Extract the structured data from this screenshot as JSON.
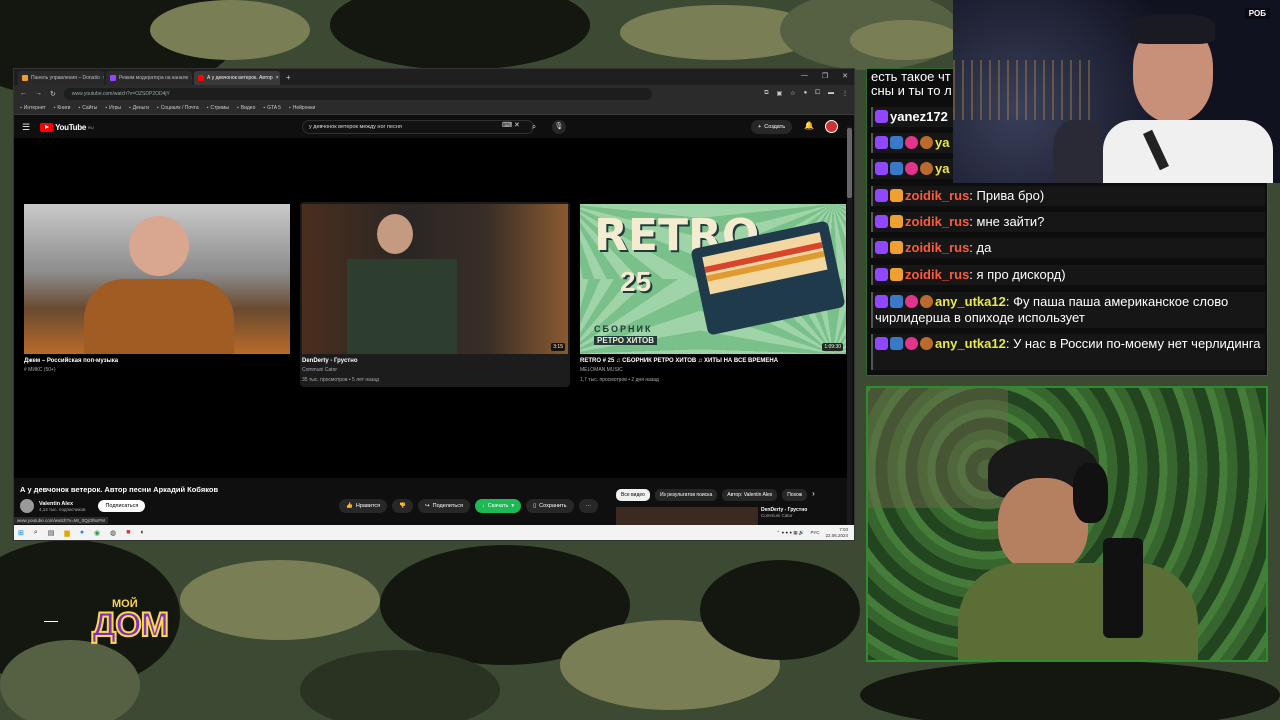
{
  "browser": {
    "tabs": [
      {
        "label": "Панель управления – Donatio",
        "color": "#f79b2e"
      },
      {
        "label": "Режим модератора на канале",
        "color": "#9146ff"
      },
      {
        "label": "А у девчонок ветерок. Автор",
        "color": "#ff0000"
      }
    ],
    "newtab": "+",
    "url": "www.youtube.com/watch?v=OZSDP2OD4jY",
    "bookmarks": [
      "Интернет",
      "Книги",
      "Сайты",
      "Игры",
      "Деньги",
      "Социалк / Почта",
      "Стримы",
      "Видео",
      "GTA 5",
      "Нейронки"
    ]
  },
  "youtube": {
    "logo": "YouTube",
    "region": "RU",
    "search": "у девчонок ветерок между ног песня",
    "create": "Создать",
    "cards": [
      {
        "title": "Джем – Российская поп-музыка",
        "meta1": "# МИКС (50+)",
        "meta2": "",
        "duration": ""
      },
      {
        "title": "DenDerty - Грустно",
        "meta1": "Communi Cator",
        "meta2": "35 тыс. просмотров • 5 лет назад",
        "duration": "3:15"
      },
      {
        "title": "RETRO # 25 ♫ СБОРНИК РЕТРО ХИТОВ ♫ ХИТЫ НА ВСЕ ВРЕМЕНА",
        "meta1": "MELOMAN MUSIC",
        "meta2": "1,7 тыс. просмотров • 2 дня назад",
        "duration": "1:09:30"
      }
    ],
    "retro": {
      "big": "RETRO",
      "num": "25",
      "sub1": "СБОРНИК",
      "sub2": "РЕТРО ХИТОВ"
    },
    "video_title": "А у девчонок ветерок. Автор песни Аркадий Кобяков",
    "channel": "Valentin Alex",
    "subs": "4,14 тыс. подписчиков",
    "subscribe": "Подписаться",
    "actions": {
      "like": "Нравится",
      "share": "Поделиться",
      "download": "Скачать",
      "save": "Сохранить",
      "more": "···"
    },
    "chips": [
      "Все видео",
      "Из результатов поиска",
      "Автор: Valentin Alex",
      "Похож"
    ],
    "side": {
      "title": "DenDerty - Грустно",
      "channel": "Communi Cator"
    },
    "status_url": "www.youtube.com/watch?v=Mr_0QjOf6oFM",
    "clock": "7:03",
    "date": "22.06.2024",
    "lang": "РУС"
  },
  "chat": {
    "partial1": "есть такое чт",
    "partial2": "сны и ты то л",
    "messages": [
      {
        "user": "yanez172",
        "color": "#ffffff",
        "text": ""
      },
      {
        "user": "ya",
        "color": "#e8e84a",
        "text": ""
      },
      {
        "user": "ya",
        "color": "#e8e84a",
        "text": ""
      },
      {
        "user": "zoidik_rus",
        "color": "#ff5a3c",
        "text": "Прива бро)"
      },
      {
        "user": "zoidik_rus",
        "color": "#ff5a3c",
        "text": "мне зайти?"
      },
      {
        "user": "zoidik_rus",
        "color": "#ff5a3c",
        "text": "да"
      },
      {
        "user": "zoidik_rus",
        "color": "#ff5a3c",
        "text": "я про дискорд)"
      },
      {
        "user": "any_utka12",
        "color": "#e8e84a",
        "text": "Фу паша паша американское слово чирлидерша в опиходе использует"
      },
      {
        "user": "any_utka12",
        "color": "#e8e84a",
        "text": "У нас в России по-моему нет черлидинга"
      }
    ]
  },
  "overlay": {
    "logo_small": "МОЙ",
    "logo_big": "ДОМ",
    "cam_badge": "РОБ"
  }
}
